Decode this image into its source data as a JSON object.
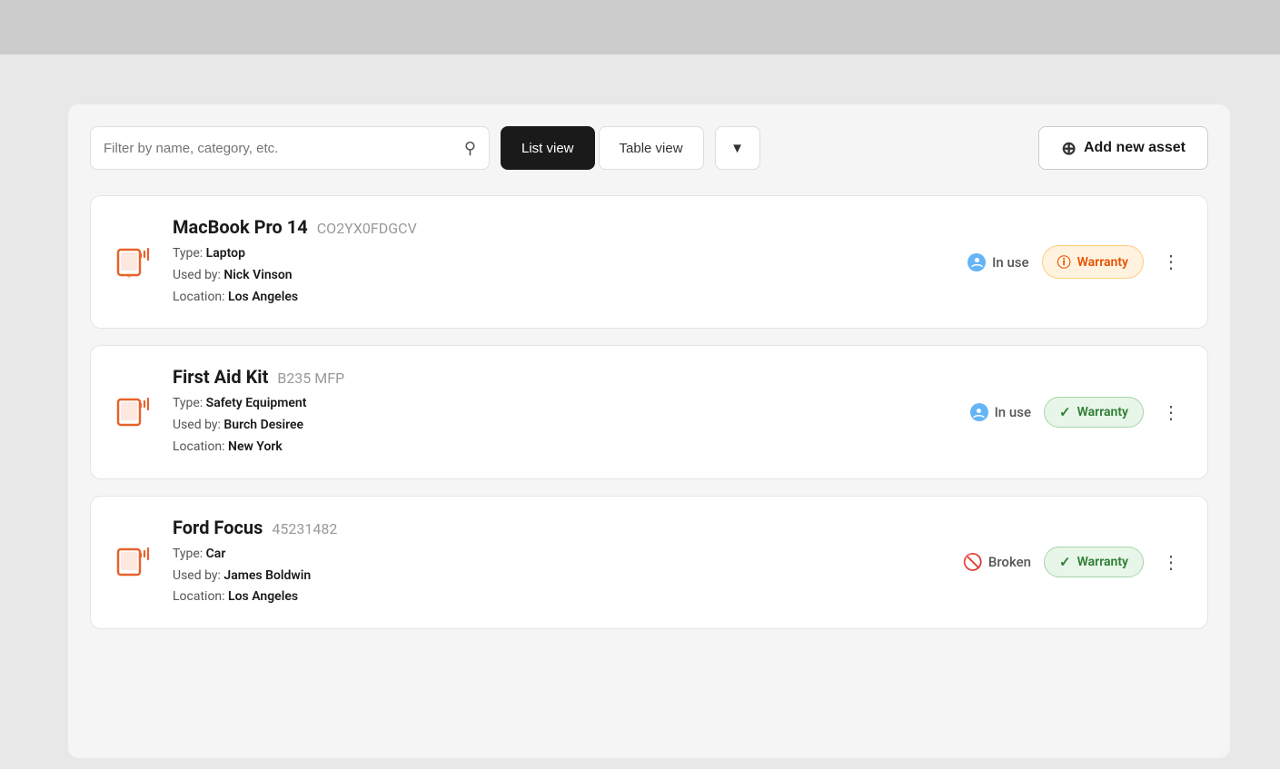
{
  "header": {
    "add_asset_label": "Add new asset"
  },
  "search": {
    "placeholder": "Filter by name, category, etc."
  },
  "views": {
    "list_label": "List view",
    "table_label": "Table view"
  },
  "assets": [
    {
      "name": "MacBook Pro 14",
      "serial": "CO2YX0FDGCV",
      "type_label": "Type:",
      "type_value": "Laptop",
      "used_by_label": "Used by:",
      "used_by_value": "Nick Vinson",
      "location_label": "Location:",
      "location_value": "Los Angeles",
      "status": "In use",
      "status_type": "in_use",
      "warranty_label": "Warranty",
      "warranty_type": "warning"
    },
    {
      "name": "First Aid Kit",
      "serial": "B235 MFP",
      "type_label": "Type:",
      "type_value": "Safety Equipment",
      "used_by_label": "Used by:",
      "used_by_value": "Burch Desiree",
      "location_label": "Location:",
      "location_value": "New York",
      "status": "In use",
      "status_type": "in_use",
      "warranty_label": "Warranty",
      "warranty_type": "ok"
    },
    {
      "name": "Ford Focus",
      "serial": "45231482",
      "type_label": "Type:",
      "type_value": "Car",
      "used_by_label": "Used by:",
      "used_by_value": "James Boldwin",
      "location_label": "Location:",
      "location_value": "Los Angeles",
      "status": "Broken",
      "status_type": "broken",
      "warranty_label": "Warranty",
      "warranty_type": "ok"
    }
  ],
  "colors": {
    "accent_orange": "#e8622a"
  }
}
